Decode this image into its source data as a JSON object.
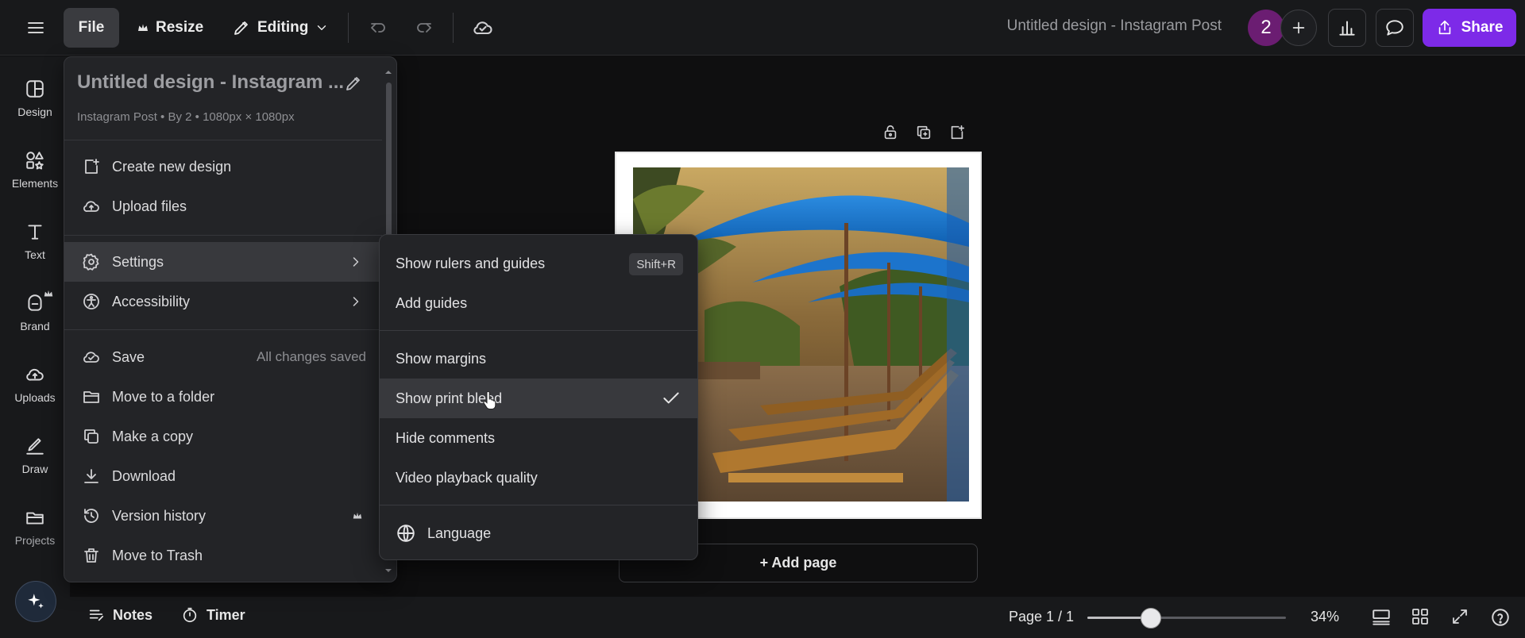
{
  "topbar": {
    "file_label": "File",
    "resize_label": "Resize",
    "editing_label": "Editing",
    "doc_title": "Untitled design - Instagram Post",
    "avatar_text": "2",
    "share_label": "Share"
  },
  "leftrail": {
    "items": [
      {
        "label": "Design",
        "icon": "design-icon"
      },
      {
        "label": "Elements",
        "icon": "elements-icon"
      },
      {
        "label": "Text",
        "icon": "text-icon"
      },
      {
        "label": "Brand",
        "icon": "brand-icon"
      },
      {
        "label": "Uploads",
        "icon": "uploads-icon"
      },
      {
        "label": "Draw",
        "icon": "draw-icon"
      },
      {
        "label": "Projects",
        "icon": "projects-icon"
      }
    ]
  },
  "file_menu": {
    "title": "Untitled design - Instagram ...",
    "meta": "Instagram Post • By 2 • 1080px × 1080px",
    "items": {
      "create": "Create new design",
      "upload": "Upload files",
      "settings": "Settings",
      "accessibility": "Accessibility",
      "save": "Save",
      "save_status": "All changes saved",
      "move_folder": "Move to a folder",
      "copy": "Make a copy",
      "download": "Download",
      "version": "Version history",
      "trash": "Move to Trash"
    }
  },
  "settings_menu": {
    "rulers": "Show rulers and guides",
    "rulers_shortcut": "Shift+R",
    "guides": "Add guides",
    "margins": "Show margins",
    "print_bleed": "Show print bleed",
    "print_bleed_checked": true,
    "hide_comments": "Hide comments",
    "video_quality": "Video playback quality",
    "language": "Language"
  },
  "canvas": {
    "add_page": "+ Add page"
  },
  "bottombar": {
    "notes": "Notes",
    "timer": "Timer",
    "page_indicator": "Page 1 / 1",
    "zoom_value": "34%",
    "zoom_fraction": 0.32
  }
}
